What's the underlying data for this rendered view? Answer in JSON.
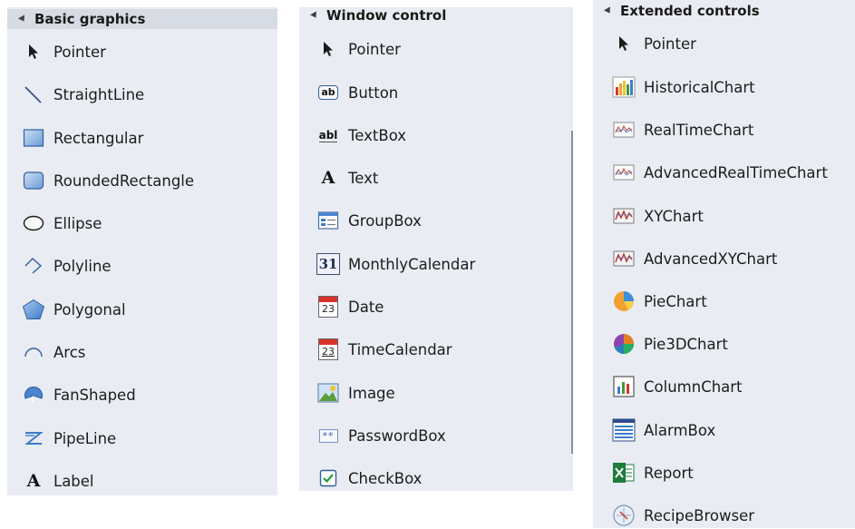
{
  "panels": [
    {
      "header": "Basic graphics",
      "items": [
        {
          "label": "Pointer",
          "icon": "pointer-icon"
        },
        {
          "label": "StraightLine",
          "icon": "straight-line-icon"
        },
        {
          "label": "Rectangular",
          "icon": "rectangle-icon"
        },
        {
          "label": "RoundedRectangle",
          "icon": "rounded-rectangle-icon"
        },
        {
          "label": "Ellipse",
          "icon": "ellipse-icon"
        },
        {
          "label": "Polyline",
          "icon": "polyline-icon"
        },
        {
          "label": "Polygonal",
          "icon": "polygon-icon"
        },
        {
          "label": "Arcs",
          "icon": "arc-icon"
        },
        {
          "label": "FanShaped",
          "icon": "fan-shape-icon"
        },
        {
          "label": "PipeLine",
          "icon": "pipeline-icon"
        },
        {
          "label": "Label",
          "icon": "label-icon"
        }
      ]
    },
    {
      "header": "Window control",
      "items": [
        {
          "label": "Pointer",
          "icon": "pointer-icon"
        },
        {
          "label": "Button",
          "icon": "button-icon",
          "glyph": "ab"
        },
        {
          "label": "TextBox",
          "icon": "textbox-icon",
          "glyph": "abl"
        },
        {
          "label": "Text",
          "icon": "text-icon",
          "glyph": "A"
        },
        {
          "label": "GroupBox",
          "icon": "groupbox-icon"
        },
        {
          "label": "MonthlyCalendar",
          "icon": "monthly-calendar-icon",
          "glyph": "31"
        },
        {
          "label": "Date",
          "icon": "date-icon",
          "glyph": "23"
        },
        {
          "label": "TimeCalendar",
          "icon": "time-calendar-icon",
          "glyph": "23"
        },
        {
          "label": "Image",
          "icon": "image-icon"
        },
        {
          "label": "PasswordBox",
          "icon": "password-box-icon",
          "glyph": "**"
        },
        {
          "label": "CheckBox",
          "icon": "checkbox-icon"
        }
      ]
    },
    {
      "header": "Extended controls",
      "items": [
        {
          "label": "Pointer",
          "icon": "pointer-icon"
        },
        {
          "label": "HistoricalChart",
          "icon": "historical-chart-icon"
        },
        {
          "label": "RealTimeChart",
          "icon": "realtime-chart-icon"
        },
        {
          "label": "AdvancedRealTimeChart",
          "icon": "advanced-realtime-chart-icon"
        },
        {
          "label": "XYChart",
          "icon": "xy-chart-icon"
        },
        {
          "label": "AdvancedXYChart",
          "icon": "advanced-xy-chart-icon"
        },
        {
          "label": "PieChart",
          "icon": "pie-chart-icon"
        },
        {
          "label": "Pie3DChart",
          "icon": "pie-3d-chart-icon"
        },
        {
          "label": "ColumnChart",
          "icon": "column-chart-icon"
        },
        {
          "label": "AlarmBox",
          "icon": "alarm-box-icon"
        },
        {
          "label": "Report",
          "icon": "report-excel-icon"
        },
        {
          "label": "RecipeBrowser",
          "icon": "recipe-browser-icon"
        }
      ]
    }
  ],
  "colors": {
    "panel_bg": "#e9ecf2",
    "header_bg": "#d7dbe3",
    "accent_blue": "#3d7cc9",
    "calendar_red": "#d8332a",
    "excel_green": "#1e7b3c"
  }
}
